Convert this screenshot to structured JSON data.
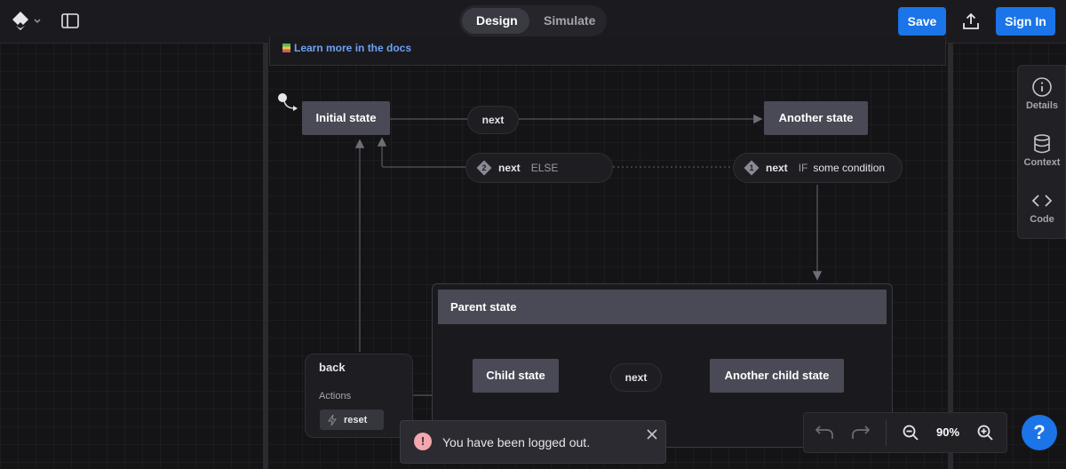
{
  "toolbar": {
    "modes": [
      {
        "label": "Design",
        "active": true
      },
      {
        "label": "Simulate",
        "active": false
      }
    ],
    "save_label": "Save",
    "sign_in_label": "Sign In"
  },
  "canvas": {
    "docs_link": "Learn more in the docs",
    "states": {
      "initial": "Initial state",
      "another": "Another state",
      "parent": "Parent state",
      "child": "Child state",
      "another_child": "Another child state"
    },
    "transitions": {
      "next_top": "next",
      "next_child": "next",
      "guard_else": {
        "index": "2",
        "event": "next",
        "keyword": "ELSE"
      },
      "guard_if": {
        "index": "1",
        "event": "next",
        "keyword": "IF",
        "condition": "some condition"
      }
    },
    "back_node": {
      "event": "back",
      "actions_label": "Actions",
      "action": "reset"
    }
  },
  "right_panel": {
    "items": [
      {
        "label": "Details",
        "icon": "info-icon"
      },
      {
        "label": "Context",
        "icon": "database-icon"
      },
      {
        "label": "Code",
        "icon": "code-icon"
      }
    ]
  },
  "zoom": {
    "level": "90%"
  },
  "toast": {
    "message": "You have been logged out."
  },
  "help": {
    "label": "?"
  },
  "colors": {
    "accent": "#1b74e8",
    "state_fill": "#4a4a56",
    "background": "#141417"
  }
}
